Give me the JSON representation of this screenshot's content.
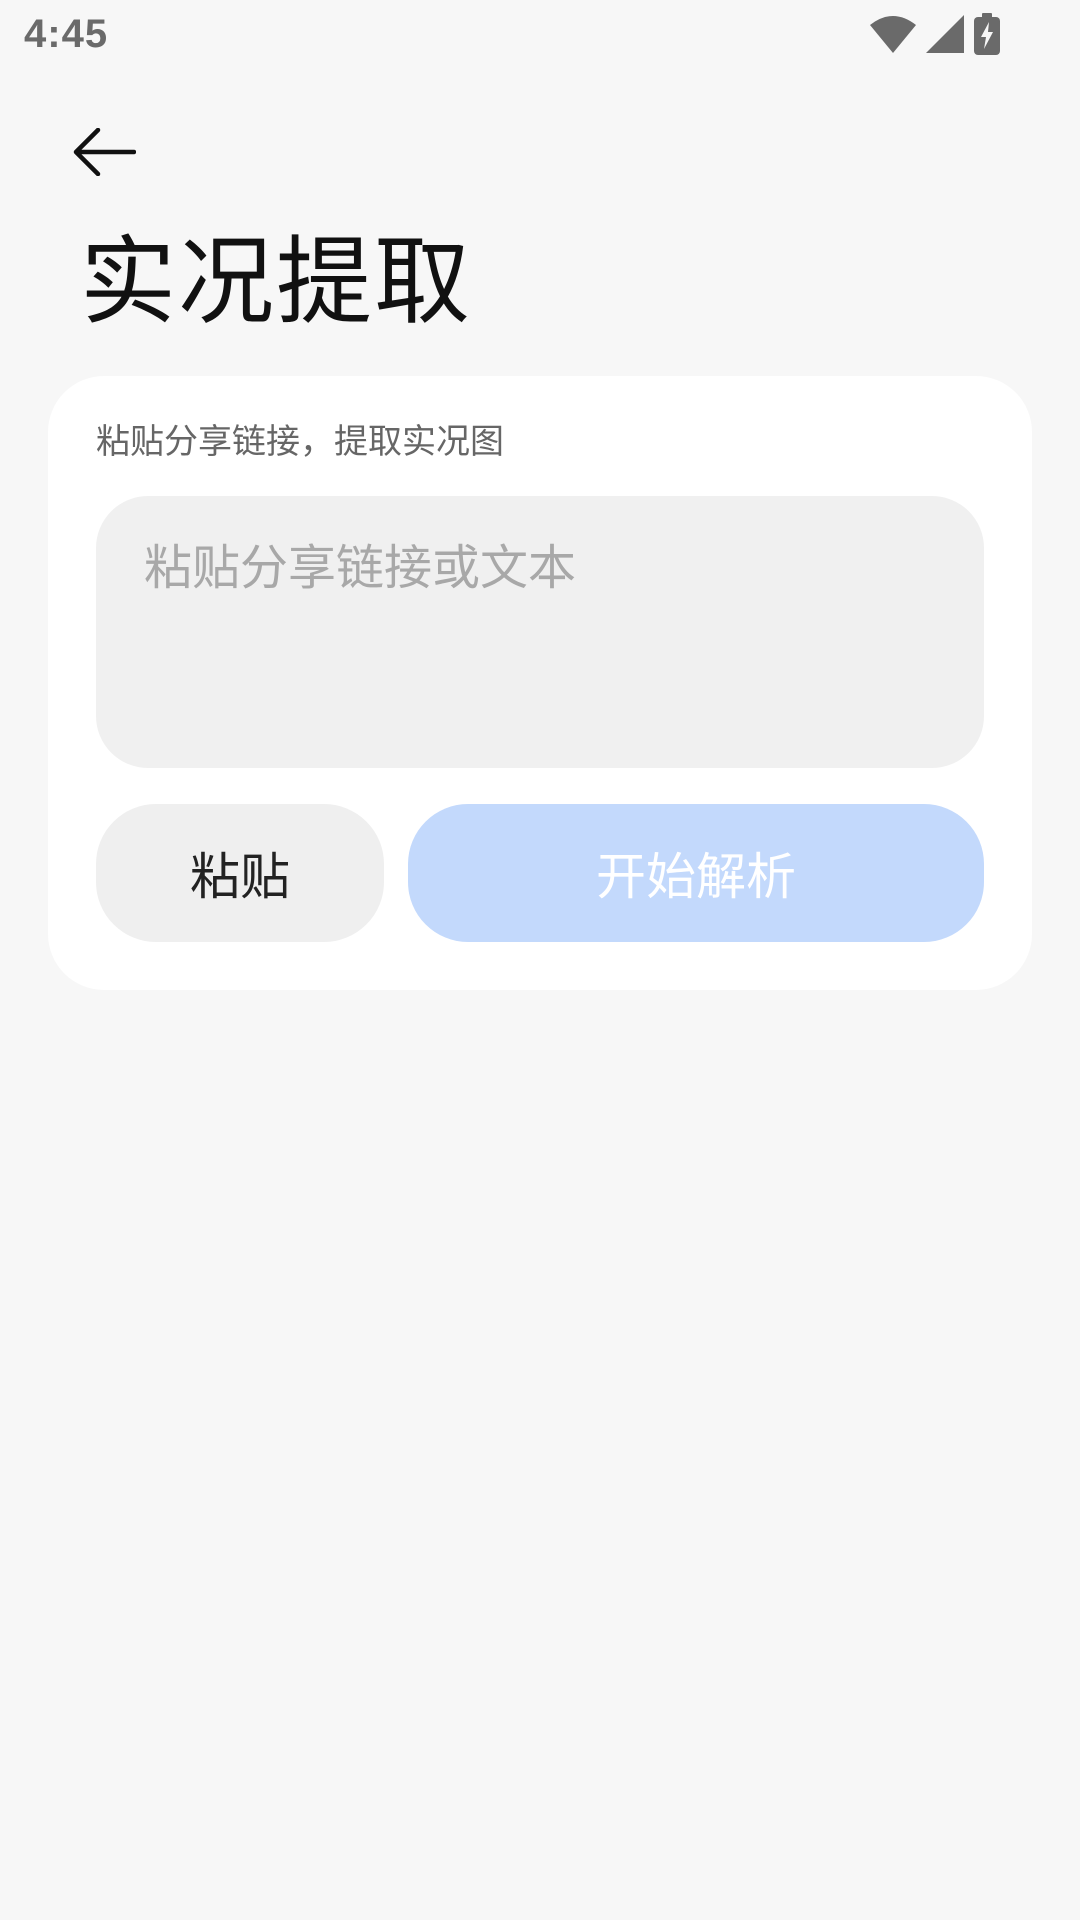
{
  "status_bar": {
    "time": "4:45",
    "icons": [
      "wifi-icon",
      "cellular-signal-icon",
      "battery-charging-icon"
    ],
    "icon_color": "#6a6a6a"
  },
  "header": {
    "back_icon": "arrow-left-icon",
    "title": "实况提取"
  },
  "card": {
    "label": "粘贴分享链接，提取实况图",
    "input": {
      "value": "",
      "placeholder": "粘贴分享链接或文本"
    },
    "paste_label": "粘贴",
    "parse_label": "开始解析"
  },
  "colors": {
    "background": "#f7f7f7",
    "card": "#ffffff",
    "input_background": "#f0f0f0",
    "paste_button": "#efefef",
    "parse_button_disabled": "#c3d9fc",
    "title_text": "#111111"
  }
}
